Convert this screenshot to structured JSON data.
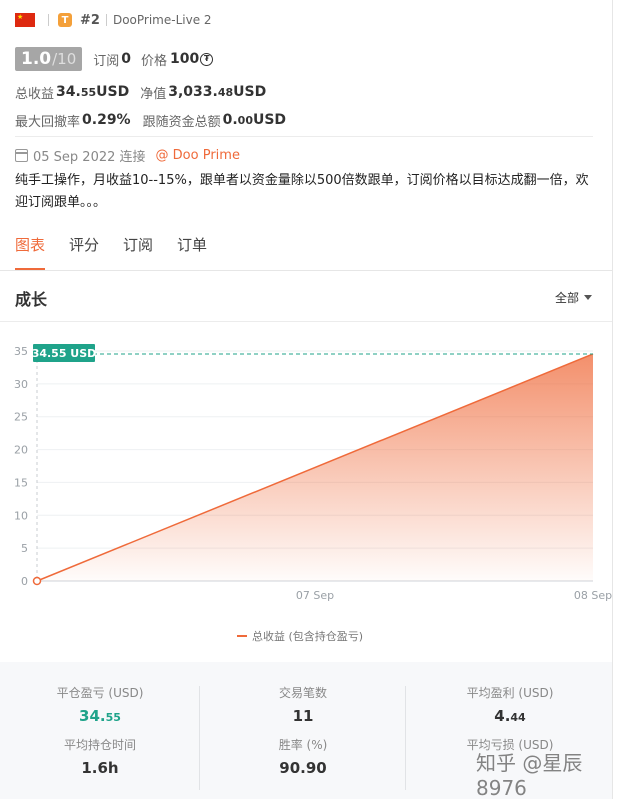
{
  "header": {
    "rank": "#2",
    "server": "DooPrime-Live 2",
    "badge": "T"
  },
  "score": {
    "value": "1.0",
    "max": "/10",
    "subscribe_label": "订阅",
    "subscribe_value": "0",
    "price_label": "价格",
    "price_value": "100"
  },
  "stats1": {
    "total_profit_label": "总收益",
    "total_profit_main": "34.",
    "total_profit_dec": "55",
    "total_profit_unit": " USD",
    "net_value_label": "净值",
    "net_value_main": "3,033.",
    "net_value_dec": "48",
    "net_value_unit": " USD"
  },
  "stats2": {
    "drawdown_label": "最大回撤率",
    "drawdown_value": "0.29%",
    "follow_label": "跟随资金总额",
    "follow_main": "0.",
    "follow_dec": "00",
    "follow_unit": " USD"
  },
  "connect": {
    "date": "05 Sep 2022 连接",
    "broker": "@ Doo Prime"
  },
  "description": "纯手工操作，月收益10--15%，跟单者以资金量除以500倍数跟单，订阅价格以目标达成翻一倍，欢迎订阅跟单。。。",
  "tabs": [
    "图表",
    "评分",
    "订阅",
    "订单"
  ],
  "growth": {
    "title": "成长",
    "filter": "全部"
  },
  "chart_data": {
    "type": "area",
    "x": [
      "05 Sep",
      "08 Sep"
    ],
    "values": [
      0,
      34.55
    ],
    "x_ticks": [
      "07 Sep",
      "08 Sep"
    ],
    "y_ticks": [
      0,
      5,
      10,
      15,
      20,
      25,
      30,
      35
    ],
    "ylim": [
      0,
      35
    ],
    "last_label": "34.55 USD",
    "legend": "总收益 (包含持仓盈亏)",
    "color": "#ef6a3a",
    "grid": true
  },
  "bottom_stats": {
    "closed_pl_label": "平仓盈亏 (USD)",
    "closed_pl_main": "34.",
    "closed_pl_dec": "55",
    "trades_label": "交易笔数",
    "trades_value": "11",
    "avg_profit_label": "平均盈利 (USD)",
    "avg_profit_main": "4.",
    "avg_profit_dec": "44",
    "avg_hold_label": "平均持仓时间",
    "avg_hold_value": "1.6h",
    "winrate_label": "胜率 (%)",
    "winrate_value": "90.90",
    "avg_loss_label": "平均亏损 (USD)"
  },
  "watermark": "知乎 @星辰8976"
}
